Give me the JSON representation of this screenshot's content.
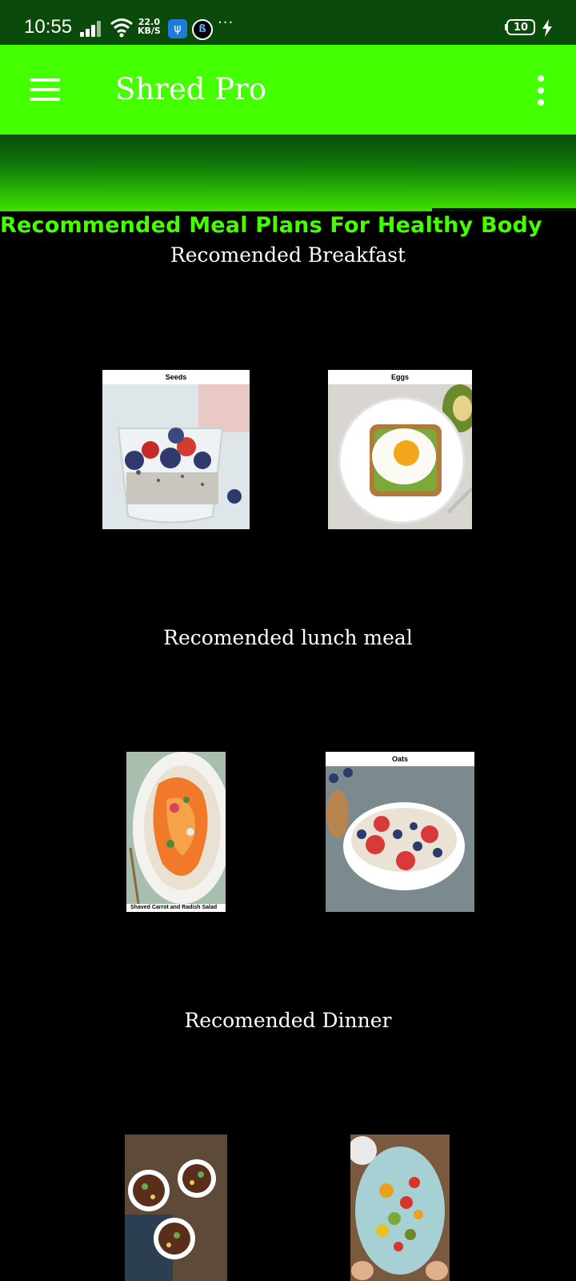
{
  "status_bar": {
    "time": "10:55",
    "net_speed_value": "22.0",
    "net_speed_unit": "KB/S",
    "battery_level": "10",
    "colors": {
      "background": "#0a4a0a"
    }
  },
  "app_bar": {
    "title": "Shred Pro",
    "menu_icon": "hamburger-menu-icon",
    "overflow_icon": "more-vert-icon",
    "colors": {
      "background": "#44ff00",
      "text": "#ffffff"
    }
  },
  "page": {
    "heading": "Recommended Meal Plans For Healthy Body",
    "heading_color": "#44ff00",
    "background": "#000000"
  },
  "sections": {
    "breakfast": {
      "title": "Recomended Breakfast",
      "items": [
        {
          "label": "Seeds"
        },
        {
          "label": "Eggs"
        }
      ]
    },
    "lunch": {
      "title": "Recomended lunch meal",
      "items": [
        {
          "label": "Shaved Carrot and Radish Salad"
        },
        {
          "label": "Oats"
        }
      ]
    },
    "dinner": {
      "title": "Recomended Dinner",
      "items": [
        {
          "label": ""
        },
        {
          "label": ""
        }
      ]
    }
  }
}
